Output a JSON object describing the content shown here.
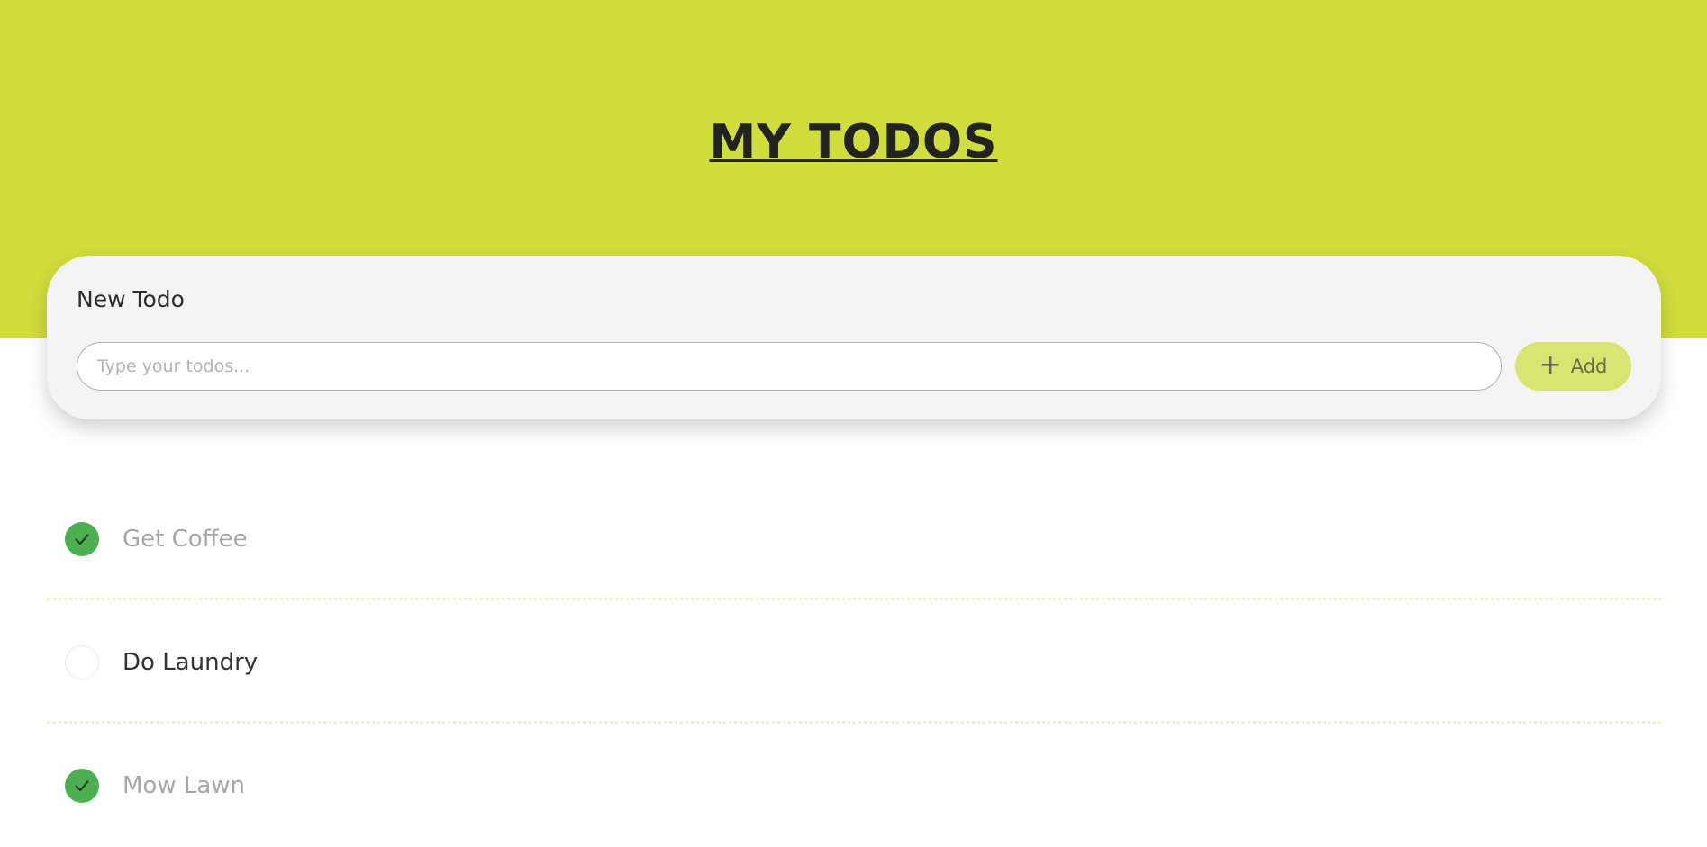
{
  "header": {
    "title": "MY TODOS",
    "background_color": "#cfde3b"
  },
  "new_todo": {
    "label": "New Todo",
    "input_value": "",
    "placeholder": "Type your todos...",
    "add_label": "Add",
    "add_icon": "plus-icon"
  },
  "todos": [
    {
      "text": "Get Coffee",
      "completed": true
    },
    {
      "text": "Do Laundry",
      "completed": false
    },
    {
      "text": "Mow Lawn",
      "completed": true
    }
  ],
  "colors": {
    "accent": "#cfde3b",
    "button": "#d8e570",
    "checked": "#4caf50"
  }
}
